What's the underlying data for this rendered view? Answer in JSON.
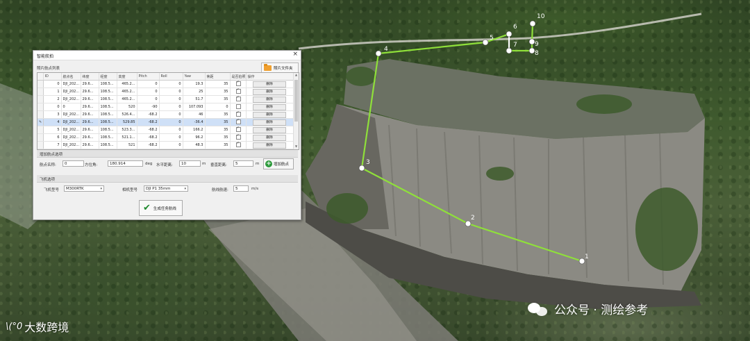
{
  "dialog": {
    "title": "智能航拍",
    "close_glyph": "×",
    "photo_list_label": "照片航点列表",
    "folder_button_label": "照片文件夹",
    "columns": [
      "ID",
      "航点名",
      "纬度",
      "经度",
      "高度",
      "Pitch",
      "Roll",
      "Yaw",
      "焦距",
      "是否拍照点",
      "操作"
    ],
    "rows": [
      {
        "id": "0",
        "name": "DJI_202...",
        "lat": "29.6...",
        "lon": "108.5...",
        "alt": "465.2...",
        "pitch": "0",
        "roll": "0",
        "yaw": "19.3",
        "focal": "35",
        "photo": true,
        "op": "删除",
        "selected": false,
        "marker": ""
      },
      {
        "id": "1",
        "name": "DJI_202...",
        "lat": "29.6...",
        "lon": "108.5...",
        "alt": "465.2...",
        "pitch": "0",
        "roll": "0",
        "yaw": "25",
        "focal": "35",
        "photo": true,
        "op": "删除",
        "selected": false,
        "marker": ""
      },
      {
        "id": "2",
        "name": "DJI_202...",
        "lat": "29.6...",
        "lon": "108.5...",
        "alt": "465.2...",
        "pitch": "0",
        "roll": "0",
        "yaw": "51.7",
        "focal": "35",
        "photo": true,
        "op": "删除",
        "selected": false,
        "marker": ""
      },
      {
        "id": "0",
        "name": "0",
        "lat": "29.6...",
        "lon": "108.5...",
        "alt": "520",
        "pitch": "-90",
        "roll": "0",
        "yaw": "107.093",
        "focal": "0",
        "photo": false,
        "op": "删除",
        "selected": false,
        "marker": ""
      },
      {
        "id": "3",
        "name": "DJI_202...",
        "lat": "29.6...",
        "lon": "108.5...",
        "alt": "526.4...",
        "pitch": "-68.2",
        "roll": "0",
        "yaw": "46",
        "focal": "35",
        "photo": true,
        "op": "删除",
        "selected": false,
        "marker": ""
      },
      {
        "id": "4",
        "name": "DJI_202...",
        "lat": "29.6...",
        "lon": "108.5...",
        "alt": "529.85",
        "pitch": "-68.2",
        "roll": "0",
        "yaw": "-36.4",
        "focal": "35",
        "photo": true,
        "op": "删除",
        "selected": true,
        "marker": "✎"
      },
      {
        "id": "5",
        "name": "DJI_202...",
        "lat": "29.6...",
        "lon": "108.5...",
        "alt": "523.3...",
        "pitch": "-68.2",
        "roll": "0",
        "yaw": "166.2",
        "focal": "35",
        "photo": true,
        "op": "删除",
        "selected": false,
        "marker": ""
      },
      {
        "id": "6",
        "name": "DJI_202...",
        "lat": "29.6...",
        "lon": "108.5...",
        "alt": "521.1...",
        "pitch": "-68.2",
        "roll": "0",
        "yaw": "96.2",
        "focal": "35",
        "photo": true,
        "op": "删除",
        "selected": false,
        "marker": ""
      },
      {
        "id": "7",
        "name": "DJI_202...",
        "lat": "29.6...",
        "lon": "108.5...",
        "alt": "521",
        "pitch": "-68.2",
        "roll": "0",
        "yaw": "48.3",
        "focal": "35",
        "photo": true,
        "op": "删除",
        "selected": false,
        "marker": ""
      }
    ],
    "add_group": {
      "header": "增加航点选项",
      "name_label": "航点名称:",
      "name_value": "0",
      "azimuth_label": "方位角:",
      "azimuth_value": "180.914",
      "azimuth_unit": "deg",
      "hdist_label": "水平距离:",
      "hdist_value": "10",
      "hdist_unit": "m",
      "vdist_label": "垂直距离:",
      "vdist_value": "5",
      "vdist_unit": "m",
      "add_button_label": "增加航点"
    },
    "flight_group": {
      "header": "飞机选项",
      "aircraft_label": "飞机型号",
      "aircraft_value": "M300RTK",
      "camera_label": "相机型号",
      "camera_value": "DJI P1 35mm",
      "speed_label": "航线航速:",
      "speed_value": "5",
      "speed_unit": "m/s"
    },
    "generate_button_label": "生成任务航线"
  },
  "route": {
    "waypoint_labels": [
      "1",
      "2",
      "3",
      "4",
      "5",
      "6",
      "7",
      "8",
      "9",
      "10"
    ],
    "line_color": "#8fe03a"
  },
  "overlay": {
    "watermark": "公众号 · 测绘参考",
    "logo_mark": "\\(°0",
    "logo_text": "大数跨境"
  }
}
